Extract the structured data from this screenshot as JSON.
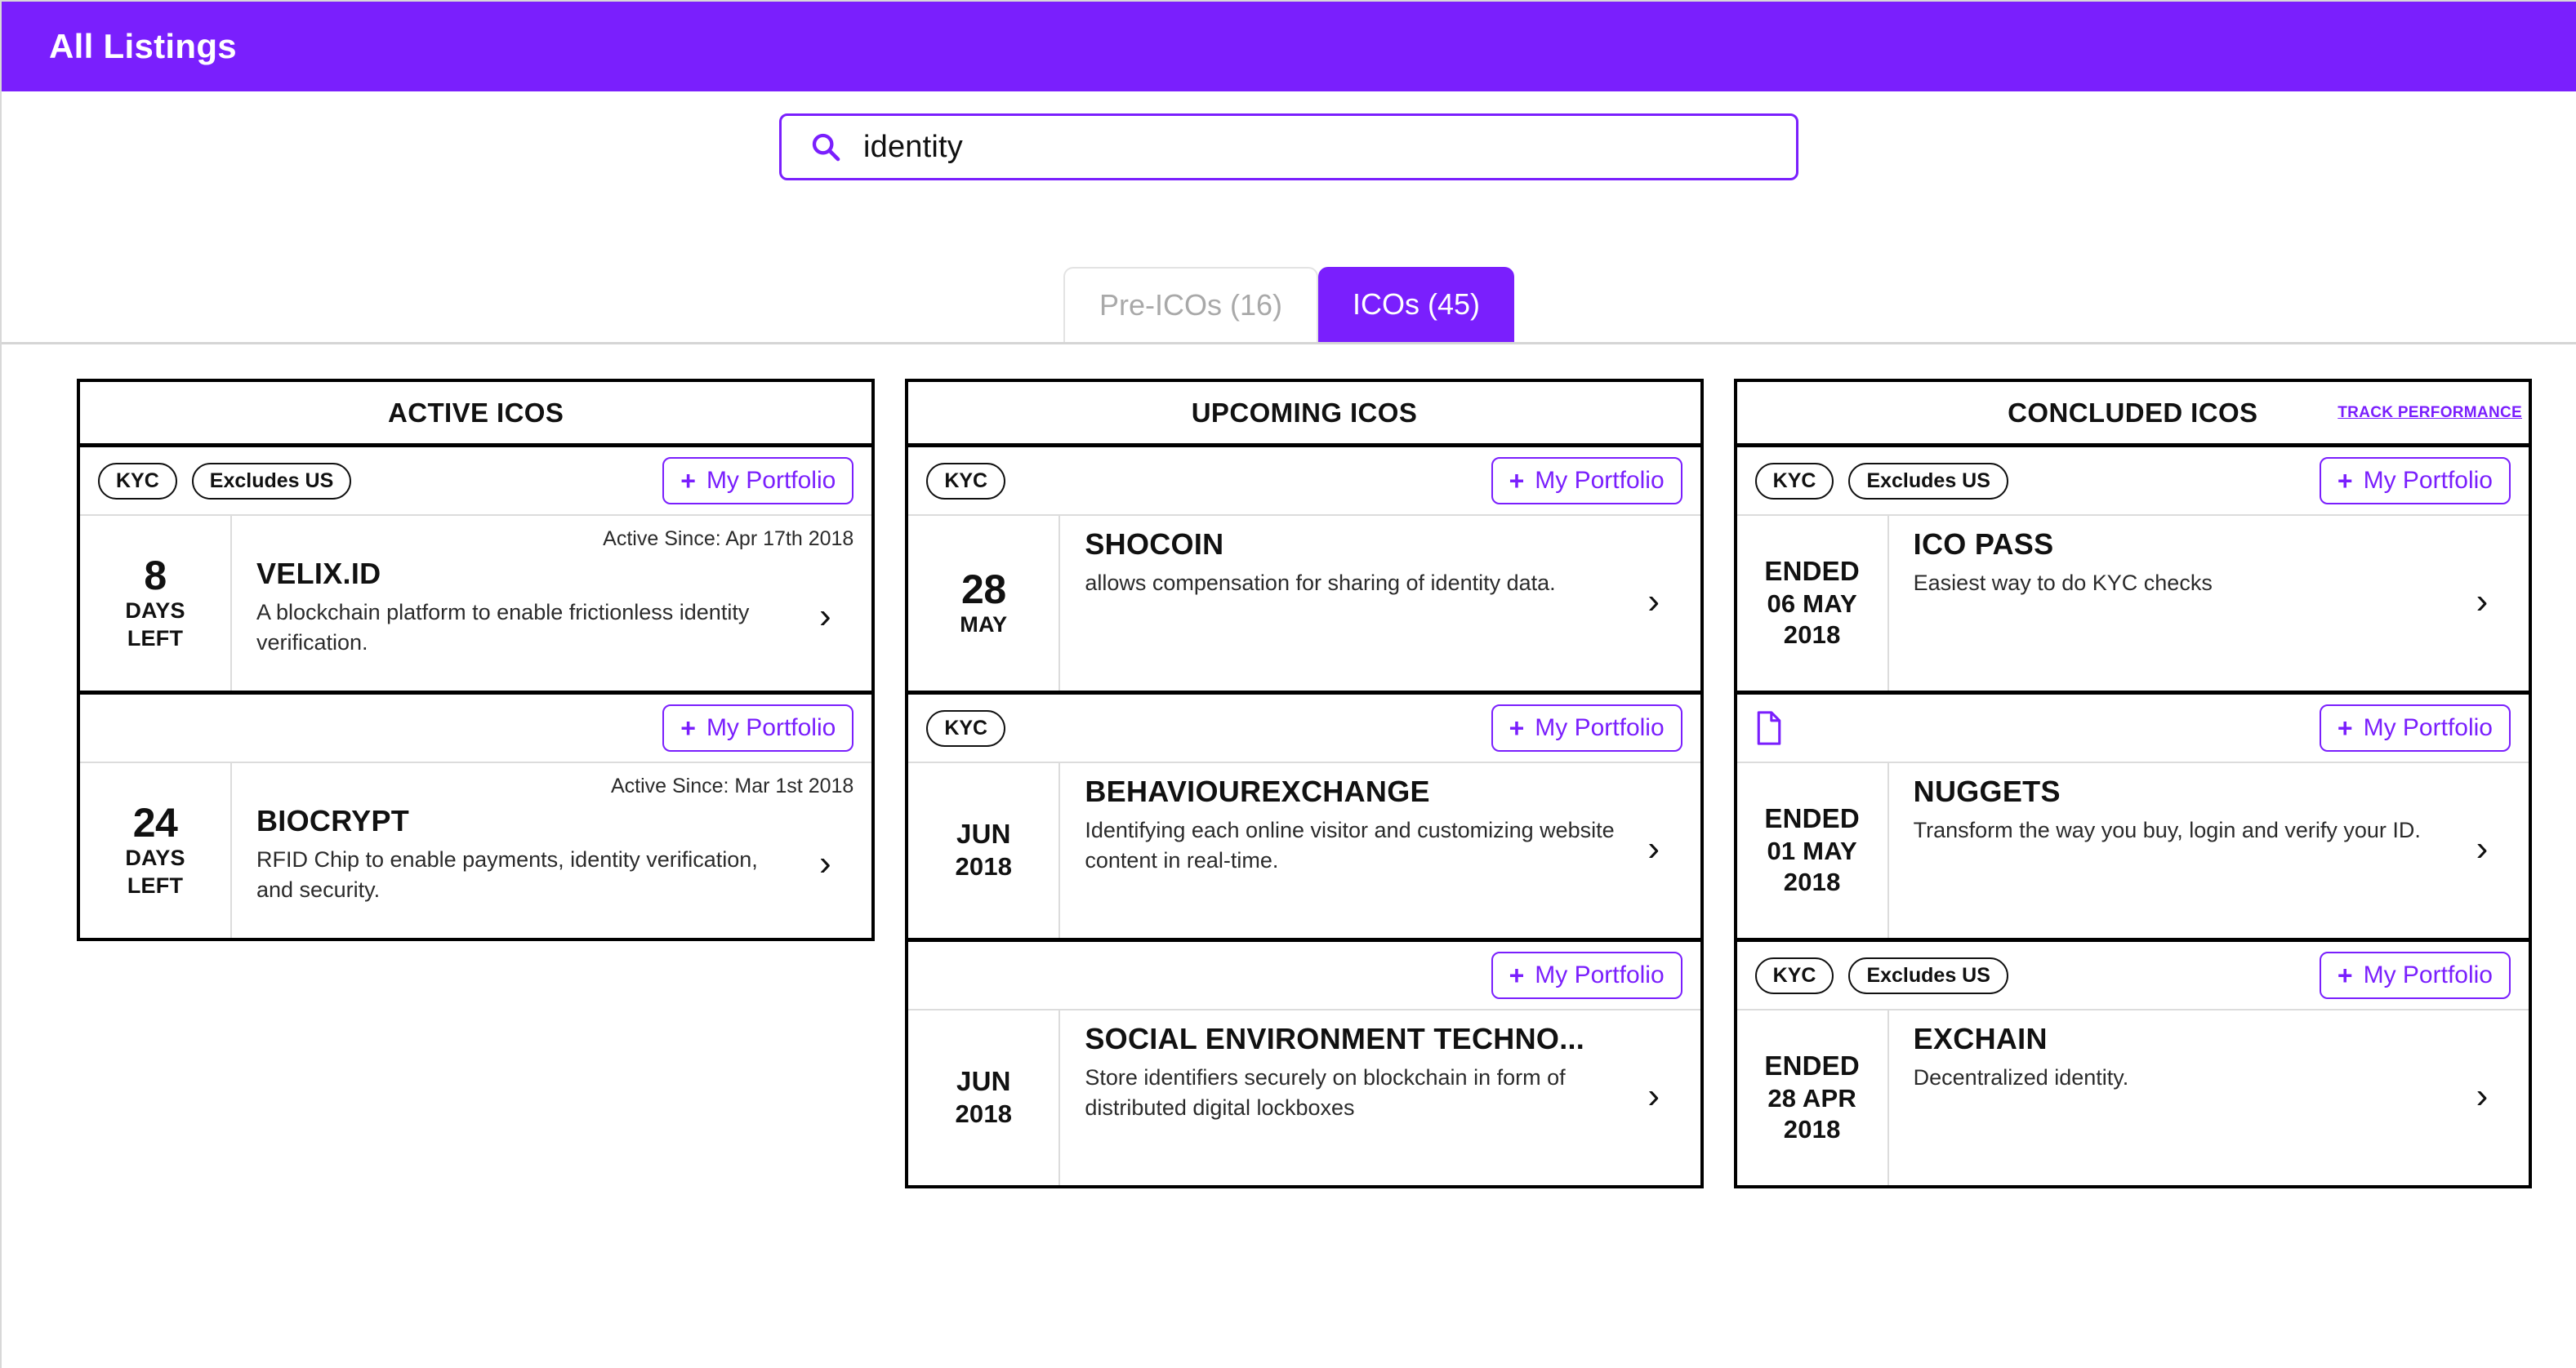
{
  "header": {
    "title": "All Listings",
    "bg_color": "#7A1FFD"
  },
  "search": {
    "icon": "search-icon",
    "value": "identity"
  },
  "tabs": [
    {
      "label": "Pre-ICOs (16)",
      "active": false
    },
    {
      "label": "ICOs (45)",
      "active": true
    }
  ],
  "accent_color": "#7A1FFD",
  "portfolio_label": "My Portfolio",
  "plus_glyph": "+",
  "chevron_glyph": "›",
  "columns": [
    {
      "title": "ACTIVE ICOS",
      "track_link": null,
      "cards": [
        {
          "chips": [
            "KYC",
            "Excludes US"
          ],
          "doc_icon": false,
          "portfolio": "My Portfolio",
          "date_big": "8",
          "date_line2": "DAYS",
          "date_line3": "LEFT",
          "since": "Active Since: Apr 17th 2018",
          "name": "VELIX.ID",
          "desc": "A blockchain platform to enable frictionless identity verification."
        },
        {
          "chips": [],
          "doc_icon": false,
          "portfolio": "My Portfolio",
          "date_big": "24",
          "date_line2": "DAYS",
          "date_line3": "LEFT",
          "since": "Active Since: Mar 1st 2018",
          "name": "BIOCRYPT",
          "desc": "RFID Chip to enable payments, identity verification, and security."
        }
      ]
    },
    {
      "title": "UPCOMING ICOS",
      "track_link": null,
      "cards": [
        {
          "chips": [
            "KYC"
          ],
          "doc_icon": false,
          "portfolio": "My Portfolio",
          "date_big": "28",
          "date_line2": "MAY",
          "date_line3": "",
          "since": "",
          "name": "SHOCOIN",
          "desc": "allows compensation for sharing of identity data."
        },
        {
          "chips": [
            "KYC"
          ],
          "doc_icon": false,
          "portfolio": "My Portfolio",
          "date_big": "JUN",
          "date_line2": "2018",
          "date_line3": "",
          "since": "",
          "name": "BEHAVIOUREXCHANGE",
          "desc": "Identifying each online visitor and customizing website content in real-time."
        },
        {
          "chips": [],
          "doc_icon": false,
          "portfolio": "My Portfolio",
          "date_big": "JUN",
          "date_line2": "2018",
          "date_line3": "",
          "since": "",
          "name": "SOCIAL ENVIRONMENT TECHNO...",
          "desc": "Store identifiers securely on blockchain in form of distributed digital lockboxes"
        }
      ]
    },
    {
      "title": "CONCLUDED ICOS",
      "track_link": "TRACK PERFORMANCE",
      "cards": [
        {
          "chips": [
            "KYC",
            "Excludes US"
          ],
          "doc_icon": false,
          "portfolio": "My Portfolio",
          "date_big": "ENDED",
          "date_line2": "06 MAY",
          "date_line3": "2018",
          "since": "",
          "name": "ICO PASS",
          "desc": "Easiest way to do KYC checks"
        },
        {
          "chips": [],
          "doc_icon": true,
          "portfolio": "My Portfolio",
          "date_big": "ENDED",
          "date_line2": "01 MAY",
          "date_line3": "2018",
          "since": "",
          "name": "NUGGETS",
          "desc": "Transform the way you buy, login and verify your ID."
        },
        {
          "chips": [
            "KYC",
            "Excludes US"
          ],
          "doc_icon": false,
          "portfolio": "My Portfolio",
          "date_big": "ENDED",
          "date_line2": "28 APR",
          "date_line3": "2018",
          "since": "",
          "name": "EXCHAIN",
          "desc": "Decentralized identity."
        }
      ]
    }
  ]
}
